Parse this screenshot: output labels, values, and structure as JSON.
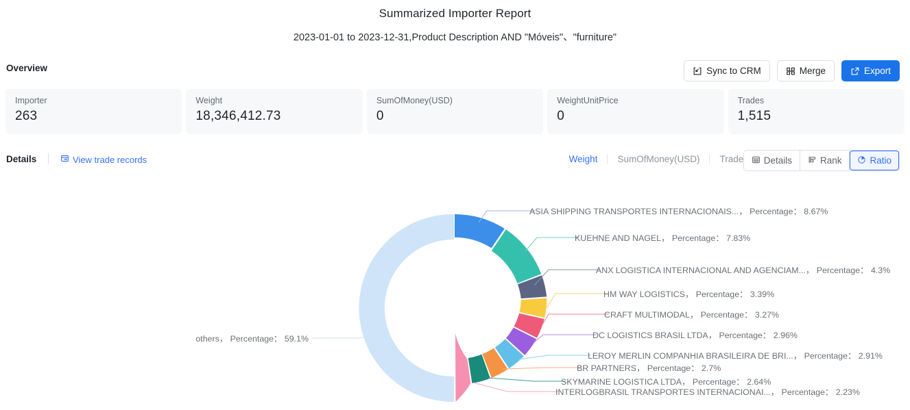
{
  "header": {
    "title": "Summarized Importer Report",
    "subtitle": "2023-01-01 to 2023-12-31,Product Description AND \"Móveis\"、\"furniture\""
  },
  "overview": {
    "label": "Overview",
    "actions": [
      {
        "label": "Sync to CRM",
        "icon": "sync-to-crm-icon",
        "primary": false
      },
      {
        "label": "Merge",
        "icon": "merge-icon",
        "primary": false
      },
      {
        "label": "Export",
        "icon": "export-icon",
        "primary": true
      }
    ],
    "stats": [
      {
        "label": "Importer",
        "value": "263"
      },
      {
        "label": "Weight",
        "value": "18,346,412.73"
      },
      {
        "label": "SumOfMoney(USD)",
        "value": "0"
      },
      {
        "label": "WeightUnitPrice",
        "value": "0"
      },
      {
        "label": "Trades",
        "value": "1,515"
      }
    ]
  },
  "details": {
    "label": "Details",
    "view_records_label": "View trade records",
    "metric_tabs": [
      {
        "label": "Weight",
        "active": true
      },
      {
        "label": "SumOfMoney(USD)",
        "active": false
      },
      {
        "label": "Trades",
        "active": false
      }
    ],
    "view_switch": [
      {
        "label": "Details",
        "icon": "table-icon",
        "active": false
      },
      {
        "label": "Rank",
        "icon": "bar-rank-icon",
        "active": false
      },
      {
        "label": "Ratio",
        "icon": "pie-icon",
        "active": true
      }
    ]
  },
  "chart_data": {
    "type": "pie",
    "title": "",
    "subtype": "donut",
    "value_label": "Percentage",
    "legend_position": "callout-labels",
    "categories": [
      "ASIA SHIPPING TRANSPORTES INTERNACIONAIS...",
      "KUEHNE AND NAGEL",
      "ANX LOGISTICA INTERNACIONAL AND AGENCIAM...",
      "HM WAY LOGISTICS",
      "CRAFT MULTIMODAL",
      "DC LOGISTICS BRASIL LTDA",
      "LEROY MERLIN COMPANHIA BRASILEIRA DE BRI...",
      "BR PARTNERS",
      "SKYMARINE LOGISTICA LTDA",
      "INTERLOGBRASIL TRANSPORTES INTERNACIONAI...",
      "others"
    ],
    "values": [
      8.67,
      7.83,
      4.3,
      3.39,
      3.27,
      2.96,
      2.91,
      2.7,
      2.64,
      2.23,
      59.1
    ],
    "unit": "%",
    "colors": [
      "#3c8ee8",
      "#35c0ad",
      "#5b6583",
      "#f7cb3d",
      "#ef5a78",
      "#9b5ede",
      "#62bfe8",
      "#f59344",
      "#1a8a7a",
      "#f78fb0",
      "#cfe4f9"
    ],
    "labels": [
      "ASIA SHIPPING TRANSPORTES INTERNACIONAIS...， Percentage： 8.67%",
      "KUEHNE AND NAGEL， Percentage： 7.83%",
      "ANX LOGISTICA INTERNACIONAL AND AGENCIAM...， Percentage： 4.3%",
      "HM WAY LOGISTICS， Percentage： 3.39%",
      "CRAFT MULTIMODAL， Percentage： 3.27%",
      "DC LOGISTICS BRASIL LTDA， Percentage： 2.96%",
      "LEROY MERLIN COMPANHIA BRASILEIRA DE BRI...， Percentage： 2.91%",
      "BR PARTNERS， Percentage： 2.7%",
      "SKYMARINE LOGISTICA LTDA， Percentage： 2.64%",
      "INTERLOGBRASIL TRANSPORTES INTERNACIONAI...， Percentage： 2.23%",
      "others， Percentage： 59.1%"
    ]
  }
}
